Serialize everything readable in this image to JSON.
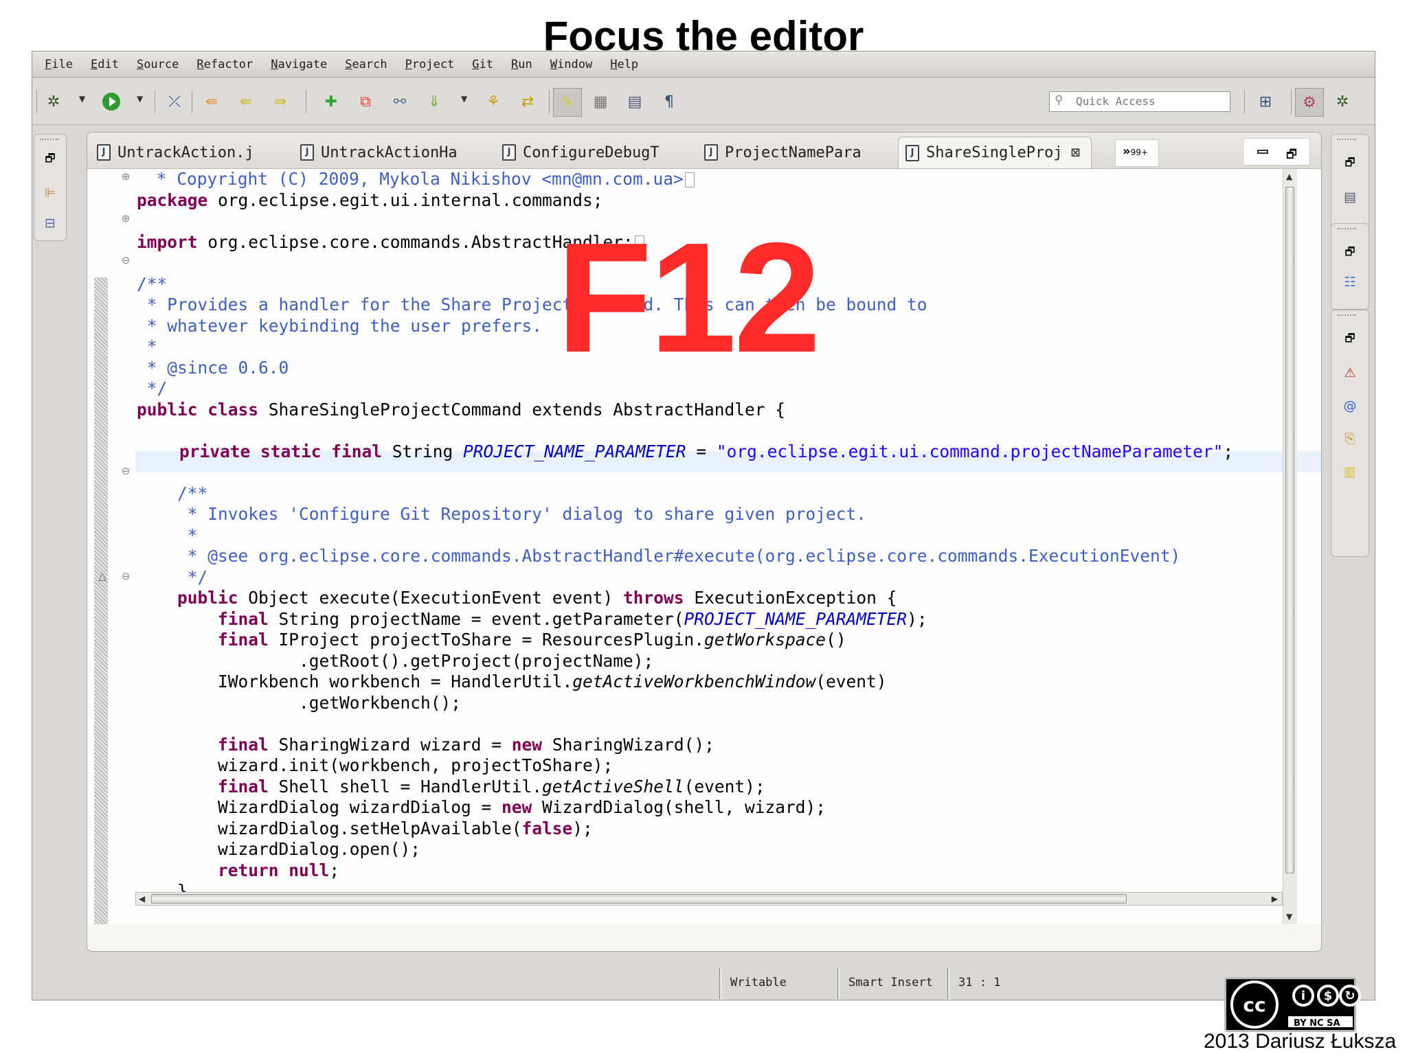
{
  "slide": {
    "title": "Focus the editor",
    "overlay_key": "F12",
    "credit": "2013 Dariusz Łuksza",
    "license_badge": "BY NC SA"
  },
  "menubar": [
    "File",
    "Edit",
    "Source",
    "Refactor",
    "Navigate",
    "Search",
    "Project",
    "Git",
    "Run",
    "Window",
    "Help"
  ],
  "toolbar": {
    "quick_access_placeholder": "Quick Access",
    "icons": [
      "debug-icon",
      "run-icon",
      "skip-breakpoints-icon",
      "open-type-icon",
      "new-java-class-icon",
      "open-task-icon",
      "new-package-icon",
      "git-commit-icon",
      "git-push-icon",
      "git-pull-icon",
      "synchronize-icon",
      "mark-occurrences-icon",
      "block-selection-icon",
      "show-whitespace-icon",
      "show-paragraph-icon",
      "open-perspective-icon",
      "git-perspective-icon",
      "debug-perspective-icon"
    ]
  },
  "editor": {
    "tabs": [
      "UntrackAction.j",
      "UntrackActionHa",
      "ConfigureDebugT",
      "ProjectNamePara",
      "ShareSingleProj"
    ],
    "active_tab": "ShareSingleProj",
    "overflow_count": "99+",
    "code_lines": [
      " * Copyright (C) 2009, Mykola Nikishov <mn@mn.com.ua>",
      "package org.eclipse.egit.ui.internal.commands;",
      "",
      "import org.eclipse.core.commands.AbstractHandler;",
      "",
      "/**",
      " * Provides a handler for the Share Project command. This can then be bound to",
      " * whatever keybinding the user prefers.",
      " *",
      " * @since 0.6.0",
      " */",
      "public class ShareSingleProjectCommand extends AbstractHandler {",
      "",
      "    private static final String PROJECT_NAME_PARAMETER = \"org.eclipse.egit.ui.command.projectNameParameter\";",
      "",
      "    /**",
      "     * Invokes 'Configure Git Repository' dialog to share given project.",
      "     *",
      "     * @see org.eclipse.core.commands.AbstractHandler#execute(org.eclipse.core.commands.ExecutionEvent)",
      "     */",
      "    public Object execute(ExecutionEvent event) throws ExecutionException {",
      "        final String projectName = event.getParameter(PROJECT_NAME_PARAMETER);",
      "        final IProject projectToShare = ResourcesPlugin.getWorkspace()",
      "                .getRoot().getProject(projectName);",
      "        IWorkbench workbench = HandlerUtil.getActiveWorkbenchWindow(event)",
      "                .getWorkbench();",
      "",
      "        final SharingWizard wizard = new SharingWizard();",
      "        wizard.init(workbench, projectToShare);",
      "        final Shell shell = HandlerUtil.getActiveShell(event);",
      "        WizardDialog wizardDialog = new WizardDialog(shell, wizard);",
      "        wizardDialog.setHelpAvailable(false);",
      "        wizardDialog.open();",
      "        return null;",
      "    }"
    ]
  },
  "statusbar": {
    "writable": "Writable",
    "insert_mode": "Smart Insert",
    "cursor_position": "31 : 1"
  },
  "colors": {
    "keyword": "#7f0055",
    "javadoc": "#3f5fbf",
    "string": "#2a00ff",
    "field": "#0000c0",
    "overlay": "#fe2b2b"
  }
}
